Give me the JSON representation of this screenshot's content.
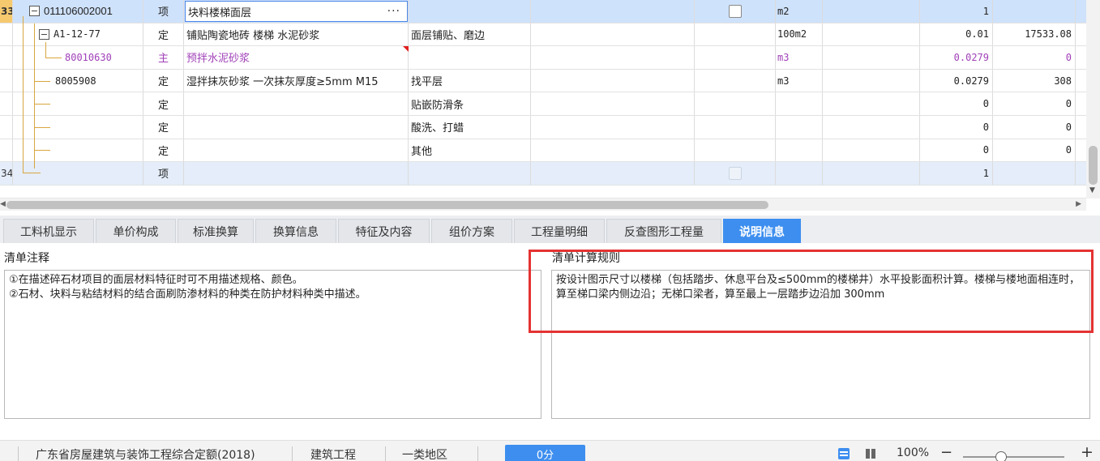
{
  "grid": {
    "rows": [
      {
        "idx": "33",
        "code": "011106002001",
        "type": "项",
        "name": "块料楼梯面层",
        "feature": "",
        "unit": "m2",
        "qty": "1",
        "price": ""
      },
      {
        "idx": "",
        "code": "A1-12-77",
        "type": "定",
        "name": "铺贴陶瓷地砖 楼梯 水泥砂浆",
        "feature": "面层铺贴、磨边",
        "unit": "100m2",
        "qty": "0.01",
        "price": "17533.08"
      },
      {
        "idx": "",
        "code": "80010630",
        "type": "主",
        "name": "预拌水泥砂浆",
        "feature": "",
        "unit": "m3",
        "qty": "0.0279",
        "price": "0"
      },
      {
        "idx": "",
        "code": "8005908",
        "type": "定",
        "name": "湿拌抹灰砂浆 一次抹灰厚度≥5mm M15",
        "feature": "找平层",
        "unit": "m3",
        "qty": "0.0279",
        "price": "308"
      },
      {
        "idx": "",
        "code": "",
        "type": "定",
        "name": "",
        "feature": "贴嵌防滑条",
        "unit": "",
        "qty": "0",
        "price": "0"
      },
      {
        "idx": "",
        "code": "",
        "type": "定",
        "name": "",
        "feature": "酸洗、打蜡",
        "unit": "",
        "qty": "0",
        "price": "0"
      },
      {
        "idx": "",
        "code": "",
        "type": "定",
        "name": "",
        "feature": "其他",
        "unit": "",
        "qty": "0",
        "price": "0"
      },
      {
        "idx": "34",
        "code": "",
        "type": "项",
        "name": "",
        "feature": "",
        "unit": "",
        "qty": "1",
        "price": ""
      }
    ],
    "edit_button": "···"
  },
  "tabs": [
    {
      "label": "工料机显示"
    },
    {
      "label": "单价构成"
    },
    {
      "label": "标准换算"
    },
    {
      "label": "换算信息"
    },
    {
      "label": "特征及内容"
    },
    {
      "label": "组价方案"
    },
    {
      "label": "工程量明细"
    },
    {
      "label": "反查图形工程量"
    },
    {
      "label": "说明信息"
    }
  ],
  "notes": {
    "left_title": "清单注释",
    "left_line1": "①在描述碎石材项目的面层材料特征时可不用描述规格、颜色。",
    "left_line2": "②石材、块料与粘结材料的结合面刷防渗材料的种类在防护材料种类中描述。",
    "right_title": "清单计算规则",
    "right_text": "按设计图示尺寸以楼梯（包括踏步、休息平台及≤500mm的楼梯井）水平投影面积计算。楼梯与楼地面相连时，算至梯口梁内侧边沿；无梯口梁者，算至最上一层踏步边沿加 300mm"
  },
  "status": {
    "quota": "广东省房屋建筑与装饰工程综合定额(2018)",
    "category": "建筑工程",
    "region": "一类地区",
    "score": "0分",
    "zoom": "100%",
    "zoom_minus": "−",
    "zoom_plus": "+"
  },
  "colors": {
    "accent": "#3d8eef",
    "selected_row": "#cfe2fb",
    "material_text": "#a040b8",
    "highlight_frame": "#e53232"
  }
}
